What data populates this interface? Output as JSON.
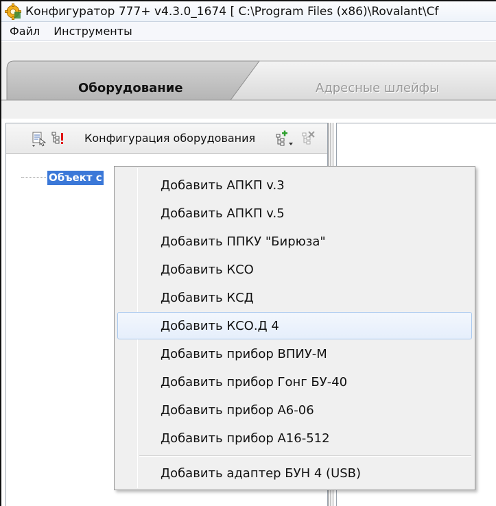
{
  "window": {
    "title": "Конфигуратор 777+ v4.3.0_1674 [ C:\\Program Files (x86)\\Rovalant\\Cf"
  },
  "menubar": {
    "items": [
      "Файл",
      "Инструменты"
    ]
  },
  "tabs": {
    "active": "Оборудование",
    "inactive": "Адресные шлейфы"
  },
  "toolbar": {
    "title": "Конфигурация оборудования"
  },
  "tree": {
    "root": "Объект с"
  },
  "context_menu": {
    "items": [
      "Добавить АПКП v.3",
      "Добавить АПКП v.5",
      "Добавить ППКУ \"Бирюза\"",
      "Добавить КСО",
      "Добавить КСД",
      "Добавить КСО.Д 4",
      "Добавить прибор ВПИУ-М",
      "Добавить прибор Гонг БУ-40",
      "Добавить прибор А6-06",
      "Добавить прибор А16-512",
      "Добавить адаптер БУН 4 (USB)"
    ],
    "hovered_index": 5
  },
  "colors": {
    "selection": "#3b78d8",
    "hover_border": "#a8c8ee",
    "menu_bg": "#f0f0f0"
  }
}
